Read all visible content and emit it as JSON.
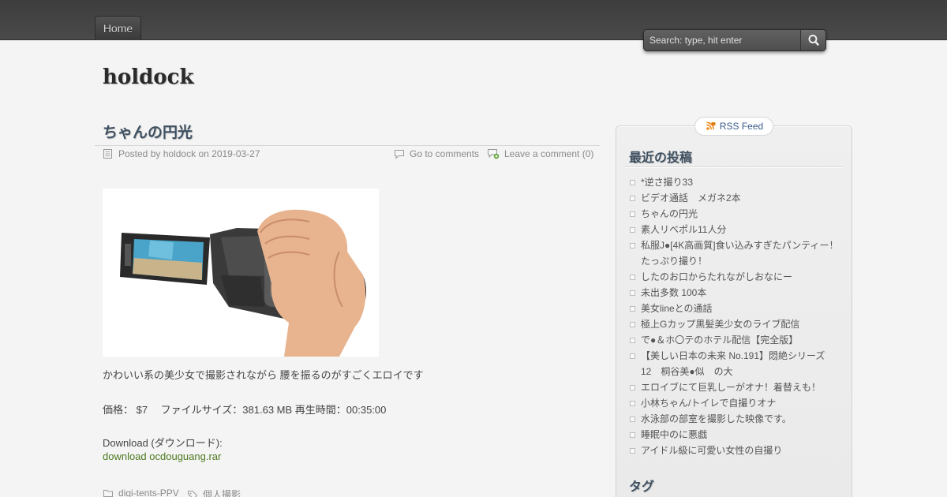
{
  "nav": {
    "home_label": "Home"
  },
  "search": {
    "placeholder": "Search: type, hit enter"
  },
  "site": {
    "title": "holdock"
  },
  "post": {
    "title": "ちゃんの円光",
    "posted_by_label": "Posted by",
    "author": "holdock",
    "on_label": "on",
    "date": "2019-03-27",
    "go_to_comments": "Go to comments",
    "leave_comment": "Leave a comment (0)",
    "description": "かわいい系の美少女で撮影されながら 腰を振るのがすごくエロイです",
    "price_line": "価格： $7　 ファイルサイズ：381.63 MB 再生時間：00:35:00",
    "download_heading": "Download (ダウンロード):",
    "download_link": "download ocdouguang.rar",
    "category": "digi-tents-PPV",
    "tag": "個人撮影"
  },
  "sidebar": {
    "rss_label": "RSS Feed",
    "recent_title": "最近の投稿",
    "recent_posts": [
      "*逆さ撮り33",
      "ビデオ通話　メガネ2本",
      "ちゃんの円光",
      "素人リベポル11人分",
      "私服J●[4K高画質]食い込みすぎたパンティー！",
      "したのお口からたれながしおなにー",
      "未出多数 100本",
      "美女lineとの通話",
      "極上Gカップ黒髪美少女のライブ配信",
      "で●＆ホ〇テのホテル配信【完全版】",
      "【美しい日本の未来 No.191】悶絶シリーズ",
      "エロイブにて巨乳しーがオナ！着替えも！",
      "小林ちゃん/トイレで自撮りオナ",
      "水泳部の部室を撮影した映像です。",
      "睡眠中のに悪戯",
      "アイドル級に可愛い女性の自撮り"
    ],
    "recent_post_continuations": {
      "4": "たっぷり撮り！",
      "10": "12　桐谷美●似　の大"
    },
    "tags_title": "タグ"
  },
  "colors": {
    "topbar": "#444444",
    "title_blue": "#3e4f60",
    "link_green": "#4e7a1f",
    "rss_blue": "#3a5a8c"
  }
}
